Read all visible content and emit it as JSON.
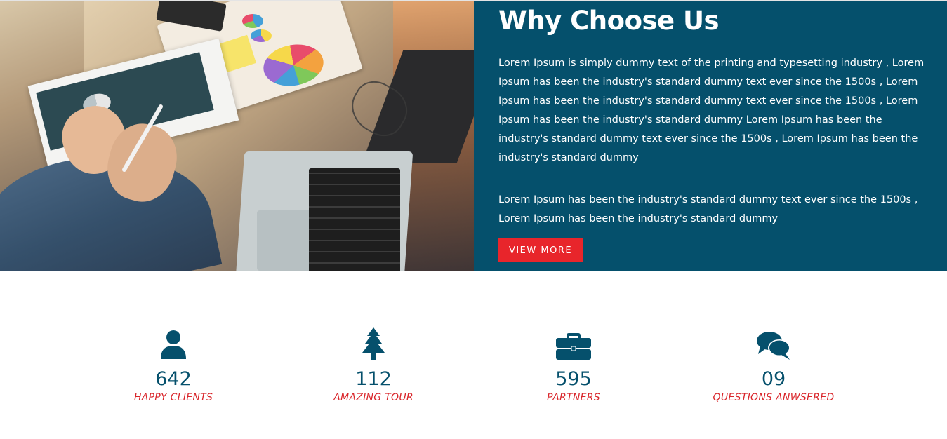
{
  "why": {
    "title": "Why Choose Us",
    "paragraph1": "Lorem Ipsum is simply dummy text of the printing and typesetting industry , Lorem Ipsum has been the industry's standard dummy text ever since the 1500s , Lorem Ipsum has been the industry's standard dummy text ever since the 1500s , Lorem Ipsum has been the industry's standard dummy Lorem Ipsum has been the industry's standard dummy text ever since the 1500s , Lorem Ipsum has been the industry's standard dummy",
    "paragraph2": "Lorem Ipsum has been the industry's standard dummy text ever since the 1500s , Lorem Ipsum has been the industry's standard dummy",
    "button_label": "VIEW MORE"
  },
  "stats": [
    {
      "icon": "user-icon",
      "number": "642",
      "label": "HAPPY CLIENTS"
    },
    {
      "icon": "tree-icon",
      "number": "112",
      "label": "AMAZING TOUR"
    },
    {
      "icon": "briefcase-icon",
      "number": "595",
      "label": "PARTNERS"
    },
    {
      "icon": "comments-icon",
      "number": "09",
      "label": "QUESTIONS ANWSERED"
    }
  ],
  "colors": {
    "panel": "#05506c",
    "accent": "#e8252b",
    "number": "#05506c",
    "label": "#d9252a"
  }
}
